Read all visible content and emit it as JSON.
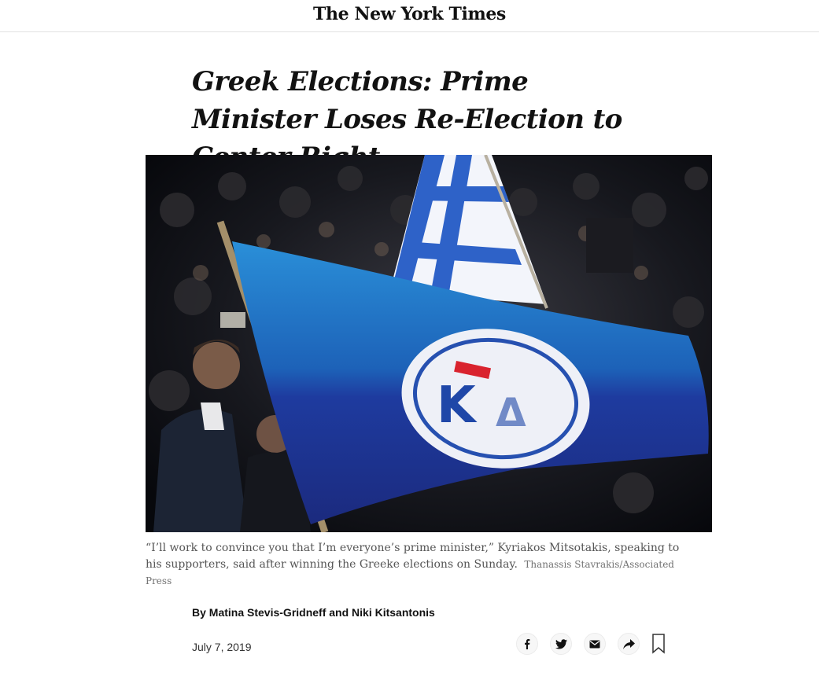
{
  "masthead": {
    "logo": "The New York Times"
  },
  "article": {
    "headline": "Greek Elections: Prime Minister Loses Re-Election to Center Right",
    "caption": "“I’ll work to convince you that I’m everyone’s prime minister,” Kyriakos Mitsotakis, speaking to his supporters, said after winning the Greeke elections on Sunday.",
    "credit": "Thanassis Stavrakis/Associated Press",
    "byline": "By Matina Stevis-Gridneff and Niki Kitsantonis",
    "date": "July 7, 2019"
  },
  "share_icons": [
    "facebook-icon",
    "twitter-icon",
    "email-icon",
    "share-icon",
    "bookmark-icon"
  ],
  "colors": {
    "text": "#121212",
    "caption": "#555555",
    "flag_blue": "#1f5fb0",
    "flag_dark_blue": "#243a9a",
    "flag_red": "#d9232e"
  }
}
